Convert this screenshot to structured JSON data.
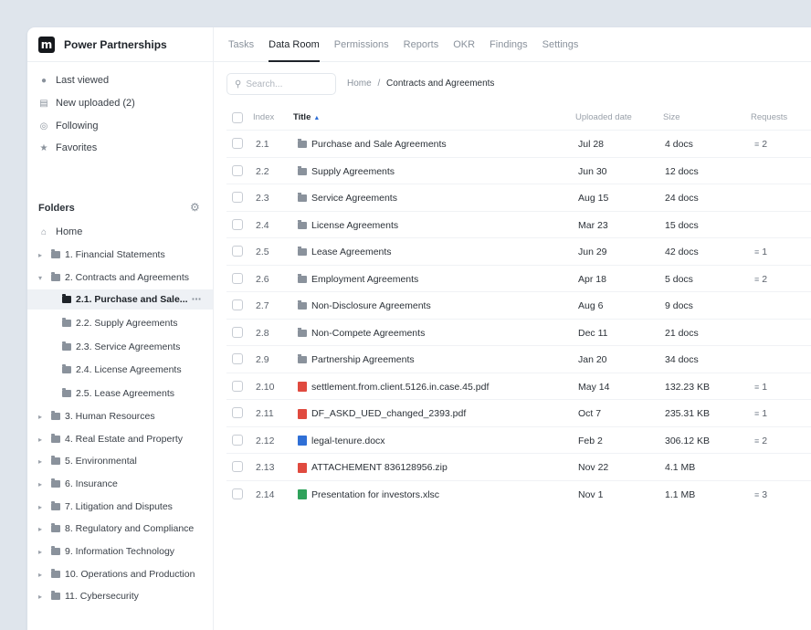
{
  "app": {
    "name": "Power Partnerships",
    "logo_letter": "m"
  },
  "tabs": [
    {
      "label": "Tasks",
      "active": false
    },
    {
      "label": "Data Room",
      "active": true
    },
    {
      "label": "Permissions",
      "active": false
    },
    {
      "label": "Reports",
      "active": false
    },
    {
      "label": "OKR",
      "active": false
    },
    {
      "label": "Findings",
      "active": false
    },
    {
      "label": "Settings",
      "active": false
    }
  ],
  "sidebar": {
    "quick": [
      {
        "label": "Last viewed",
        "icon": "clock-icon"
      },
      {
        "label": "New uploaded (2)",
        "icon": "upload-icon"
      },
      {
        "label": "Following",
        "icon": "eye-icon"
      },
      {
        "label": "Favorites",
        "icon": "star-icon"
      }
    ],
    "folders_heading": "Folders",
    "home_label": "Home",
    "tree": [
      {
        "label": "1. Financial Statements",
        "level": 0,
        "expanded": false
      },
      {
        "label": "2. Contracts and Agreements",
        "level": 0,
        "expanded": true
      },
      {
        "label": "2.1. Purchase and Sale...",
        "level": 1,
        "selected": true
      },
      {
        "label": "2.2. Supply Agreements",
        "level": 1
      },
      {
        "label": "2.3. Service Agreements",
        "level": 1
      },
      {
        "label": "2.4. License Agreements",
        "level": 1
      },
      {
        "label": "2.5. Lease Agreements",
        "level": 1
      },
      {
        "label": "3. Human Resources",
        "level": 0,
        "expanded": false
      },
      {
        "label": "4. Real Estate and Property",
        "level": 0,
        "expanded": false
      },
      {
        "label": "5. Environmental",
        "level": 0,
        "expanded": false
      },
      {
        "label": "6. Insurance",
        "level": 0,
        "expanded": false
      },
      {
        "label": "7. Litigation and Disputes",
        "level": 0,
        "expanded": false
      },
      {
        "label": "8. Regulatory and Compliance",
        "level": 0,
        "expanded": false
      },
      {
        "label": "9. Information Technology",
        "level": 0,
        "expanded": false
      },
      {
        "label": "10. Operations and Production",
        "level": 0,
        "expanded": false
      },
      {
        "label": "11. Cybersecurity",
        "level": 0,
        "expanded": false
      }
    ]
  },
  "search": {
    "placeholder": "Search..."
  },
  "breadcrumb": {
    "root": "Home",
    "separator": "/",
    "current": "Contracts and Agreements"
  },
  "table": {
    "headers": {
      "index": "Index",
      "title": "Title",
      "uploaded": "Uploaded date",
      "size": "Size",
      "requests": "Requests"
    },
    "rows": [
      {
        "index": "2.1",
        "type": "folder",
        "title": "Purchase and Sale Agreements",
        "date": "Jul 28",
        "size": "4 docs",
        "requests": "2"
      },
      {
        "index": "2.2",
        "type": "folder",
        "title": "Supply Agreements",
        "date": "Jun 30",
        "size": "12 docs",
        "requests": ""
      },
      {
        "index": "2.3",
        "type": "folder",
        "title": "Service Agreements",
        "date": "Aug 15",
        "size": "24 docs",
        "requests": ""
      },
      {
        "index": "2.4",
        "type": "folder",
        "title": "License Agreements",
        "date": "Mar 23",
        "size": "15 docs",
        "requests": ""
      },
      {
        "index": "2.5",
        "type": "folder",
        "title": "Lease Agreements",
        "date": "Jun 29",
        "size": "42 docs",
        "requests": "1"
      },
      {
        "index": "2.6",
        "type": "folder",
        "title": "Employment Agreements",
        "date": "Apr 18",
        "size": "5 docs",
        "requests": "2"
      },
      {
        "index": "2.7",
        "type": "folder",
        "title": "Non-Disclosure Agreements",
        "date": "Aug 6",
        "size": "9 docs",
        "requests": ""
      },
      {
        "index": "2.8",
        "type": "folder",
        "title": "Non-Compete Agreements",
        "date": "Dec 11",
        "size": "21 docs",
        "requests": ""
      },
      {
        "index": "2.9",
        "type": "folder",
        "title": "Partnership Agreements",
        "date": "Jan 20",
        "size": "34 docs",
        "requests": ""
      },
      {
        "index": "2.10",
        "type": "pdf",
        "title": "settlement.from.client.5126.in.case.45.pdf",
        "date": "May 14",
        "size": "132.23 KB",
        "requests": "1"
      },
      {
        "index": "2.11",
        "type": "pdf",
        "title": "DF_ASKD_UED_changed_2393.pdf",
        "date": "Oct 7",
        "size": "235.31 KB",
        "requests": "1"
      },
      {
        "index": "2.12",
        "type": "doc",
        "title": "legal-tenure.docx",
        "date": "Feb 2",
        "size": "306.12 KB",
        "requests": "2"
      },
      {
        "index": "2.13",
        "type": "zip",
        "title": "ATTACHEMENT 836128956.zip",
        "date": "Nov 22",
        "size": "4.1 MB",
        "requests": ""
      },
      {
        "index": "2.14",
        "type": "xls",
        "title": "Presentation for investors.xlsc",
        "date": "Nov 1",
        "size": "1.1 MB",
        "requests": "3"
      }
    ]
  }
}
